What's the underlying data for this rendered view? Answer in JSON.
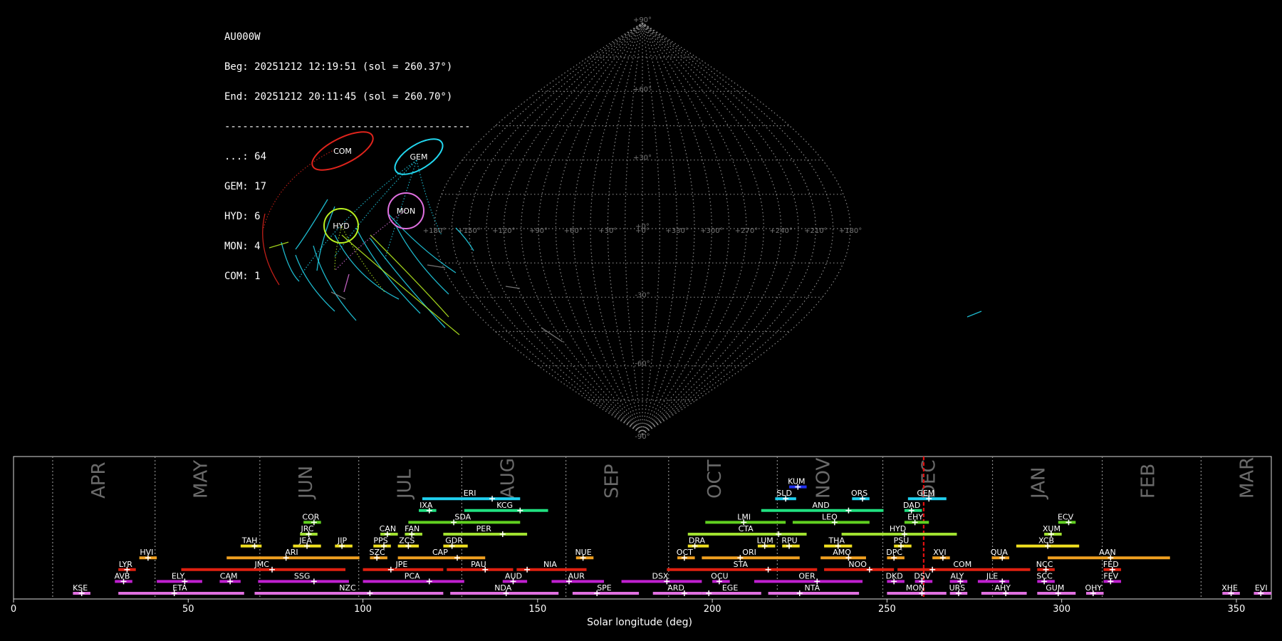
{
  "station": "AU000W",
  "beg": "Beg: 20251212 12:19:51 (sol = 260.37°)",
  "end": "End: 20251212 20:11:45 (sol = 260.70°)",
  "separator": "-----------------------------------------",
  "counts": [
    "...: 64",
    "GEM: 17",
    "HYD: 6",
    "MON: 4",
    "COM: 1"
  ],
  "sky_map": {
    "lat_labels": [
      "+90°",
      "+60°",
      "+30°",
      "+0°",
      "-30°",
      "-60°",
      "-90°"
    ],
    "lat_values": [
      90,
      60,
      30,
      0,
      -30,
      -60,
      -90
    ],
    "lon_labels": [
      "+180°",
      "+150°",
      "+120°",
      "+90°",
      "+60°",
      "+30°",
      "+0°",
      "+330°",
      "+300°",
      "+270°",
      "+240°",
      "+210°",
      "+180°"
    ],
    "radiants": [
      {
        "name": "COM",
        "color": "#e0241c"
      },
      {
        "name": "GEM",
        "color": "#22d8f0"
      },
      {
        "name": "MON",
        "color": "#e070e0"
      },
      {
        "name": "HYD",
        "color": "#b8f020"
      }
    ]
  },
  "chart_data": {
    "type": "timeline",
    "xlabel": "Solar longitude (deg)",
    "xlim": [
      0,
      360
    ],
    "xticks": [
      0,
      50,
      100,
      150,
      200,
      250,
      300,
      350
    ],
    "months": [
      {
        "label": "APR",
        "start": 11.2
      },
      {
        "label": "MAY",
        "start": 40.5
      },
      {
        "label": "JUN",
        "start": 70.5
      },
      {
        "label": "JUL",
        "start": 98.8
      },
      {
        "label": "AUG",
        "start": 128.3
      },
      {
        "label": "SEP",
        "start": 158.1
      },
      {
        "label": "OCT",
        "start": 187.5
      },
      {
        "label": "NOV",
        "start": 218.6
      },
      {
        "label": "DEC",
        "start": 248.8
      },
      {
        "label": "JAN",
        "start": 280.2
      },
      {
        "label": "FEB",
        "start": 311.6
      },
      {
        "label": "MAR",
        "start": 339.9
      }
    ],
    "current_sol": 260.5,
    "showers": [
      {
        "code": "KUM",
        "start": 222,
        "end": 227,
        "peak": 224.5,
        "row": 9,
        "color": "#2030f0"
      },
      {
        "code": "ERI",
        "start": 117,
        "end": 145,
        "peak": 137,
        "row": 8,
        "color": "#20d0f0"
      },
      {
        "code": "SLD",
        "start": 218,
        "end": 224,
        "peak": 221,
        "row": 8,
        "color": "#20d0f0"
      },
      {
        "code": "ORS",
        "start": 240,
        "end": 245,
        "peak": 243,
        "row": 8,
        "color": "#20d0f0"
      },
      {
        "code": "GEM",
        "start": 256,
        "end": 267,
        "peak": 262,
        "row": 8,
        "color": "#20d0f0"
      },
      {
        "code": "IXA",
        "start": 116,
        "end": 121,
        "peak": 119,
        "row": 7,
        "color": "#20e080"
      },
      {
        "code": "KCG",
        "start": 129,
        "end": 153,
        "peak": 145,
        "row": 7,
        "color": "#20e080"
      },
      {
        "code": "AND",
        "start": 214,
        "end": 249,
        "peak": 239,
        "row": 7,
        "color": "#20e080"
      },
      {
        "code": "DAD",
        "start": 255,
        "end": 260,
        "peak": 257,
        "row": 7,
        "color": "#20e080"
      },
      {
        "code": "COR",
        "start": 83,
        "end": 88,
        "peak": 86,
        "row": 6,
        "color": "#60d020"
      },
      {
        "code": "SDA",
        "start": 113,
        "end": 145,
        "peak": 126,
        "row": 6,
        "color": "#60d020"
      },
      {
        "code": "LMI",
        "start": 198,
        "end": 221,
        "peak": 209,
        "row": 6,
        "color": "#60d020"
      },
      {
        "code": "LEO",
        "start": 223,
        "end": 245,
        "peak": 235,
        "row": 6,
        "color": "#60d020"
      },
      {
        "code": "EHY",
        "start": 255,
        "end": 262,
        "peak": 258,
        "row": 6,
        "color": "#60d020"
      },
      {
        "code": "ECV",
        "start": 299,
        "end": 304,
        "peak": 302,
        "row": 6,
        "color": "#60d020"
      },
      {
        "code": "JRC",
        "start": 82,
        "end": 87,
        "peak": 84.5,
        "row": 5,
        "color": "#a0e030"
      },
      {
        "code": "CAN",
        "start": 105,
        "end": 110,
        "peak": 107,
        "row": 5,
        "color": "#a0e030"
      },
      {
        "code": "FAN",
        "start": 112,
        "end": 117,
        "peak": 114,
        "row": 5,
        "color": "#a0e030"
      },
      {
        "code": "PER",
        "start": 123,
        "end": 147,
        "peak": 140,
        "row": 5,
        "color": "#a0e030"
      },
      {
        "code": "CTA",
        "start": 193,
        "end": 227,
        "peak": 219,
        "row": 5,
        "color": "#a0e030"
      },
      {
        "code": "HYD",
        "start": 237,
        "end": 270,
        "peak": 255,
        "row": 5,
        "color": "#a0e030"
      },
      {
        "code": "XUM",
        "start": 295,
        "end": 300,
        "peak": 297,
        "row": 5,
        "color": "#a0e030"
      },
      {
        "code": "TAH",
        "start": 65,
        "end": 71,
        "peak": 69,
        "row": 4,
        "color": "#f0e020"
      },
      {
        "code": "JEA",
        "start": 80,
        "end": 88,
        "peak": 84,
        "row": 4,
        "color": "#f0e020"
      },
      {
        "code": "JIP",
        "start": 92,
        "end": 97,
        "peak": 94,
        "row": 4,
        "color": "#f0e020"
      },
      {
        "code": "PPS",
        "start": 103,
        "end": 108,
        "peak": 106,
        "row": 4,
        "color": "#f0e020"
      },
      {
        "code": "ZCS",
        "start": 110,
        "end": 116,
        "peak": 113,
        "row": 4,
        "color": "#f0e020"
      },
      {
        "code": "GDR",
        "start": 123,
        "end": 130,
        "peak": 125.5,
        "row": 4,
        "color": "#f0e020"
      },
      {
        "code": "DRA",
        "start": 193,
        "end": 199,
        "peak": 195,
        "row": 4,
        "color": "#f0e020"
      },
      {
        "code": "LUM",
        "start": 213,
        "end": 218,
        "peak": 215,
        "row": 4,
        "color": "#f0e020"
      },
      {
        "code": "RPU",
        "start": 220,
        "end": 225,
        "peak": 222,
        "row": 4,
        "color": "#f0e020"
      },
      {
        "code": "THA",
        "start": 232,
        "end": 240,
        "peak": 236,
        "row": 4,
        "color": "#f0e020"
      },
      {
        "code": "PSU",
        "start": 252,
        "end": 257,
        "peak": 254,
        "row": 4,
        "color": "#f0e020"
      },
      {
        "code": "XCB",
        "start": 287,
        "end": 305,
        "peak": 296,
        "row": 4,
        "color": "#f0e020"
      },
      {
        "code": "HVI",
        "start": 36,
        "end": 41,
        "peak": 38.5,
        "row": 3,
        "color": "#f0a020"
      },
      {
        "code": "ARI",
        "start": 61,
        "end": 99,
        "peak": 78,
        "row": 3,
        "color": "#f0a020"
      },
      {
        "code": "SZC",
        "start": 102,
        "end": 107,
        "peak": 104,
        "row": 3,
        "color": "#f0a020"
      },
      {
        "code": "CAP",
        "start": 110,
        "end": 135,
        "peak": 127,
        "row": 3,
        "color": "#f0a020"
      },
      {
        "code": "NUE",
        "start": 161,
        "end": 166,
        "peak": 163,
        "row": 3,
        "color": "#f0a020"
      },
      {
        "code": "OCT",
        "start": 190,
        "end": 195,
        "peak": 192,
        "row": 3,
        "color": "#f0a020"
      },
      {
        "code": "ORI",
        "start": 197,
        "end": 225,
        "peak": 208,
        "row": 3,
        "color": "#f0a020"
      },
      {
        "code": "AMO",
        "start": 231,
        "end": 244,
        "peak": 239,
        "row": 3,
        "color": "#f0a020"
      },
      {
        "code": "DPC",
        "start": 250,
        "end": 255,
        "peak": 252,
        "row": 3,
        "color": "#f0a020"
      },
      {
        "code": "XVI",
        "start": 263,
        "end": 268,
        "peak": 266,
        "row": 3,
        "color": "#f0a020"
      },
      {
        "code": "QUA",
        "start": 280,
        "end": 285,
        "peak": 283,
        "row": 3,
        "color": "#f0a020"
      },
      {
        "code": "AAN",
        "start": 296,
        "end": 331,
        "peak": 314,
        "row": 3,
        "color": "#f0a020"
      },
      {
        "code": "LYR",
        "start": 30,
        "end": 35,
        "peak": 32.5,
        "row": 2,
        "color": "#e02010"
      },
      {
        "code": "JMC",
        "start": 48,
        "end": 95,
        "peak": 74,
        "row": 2,
        "color": "#e02010"
      },
      {
        "code": "JPE",
        "start": 100,
        "end": 123,
        "peak": 108,
        "row": 2,
        "color": "#e02010"
      },
      {
        "code": "PAU",
        "start": 124,
        "end": 143,
        "peak": 135,
        "row": 2,
        "color": "#e02010"
      },
      {
        "code": "NIA",
        "start": 144,
        "end": 164,
        "peak": 147,
        "row": 2,
        "color": "#e02010"
      },
      {
        "code": "STA",
        "start": 187,
        "end": 230,
        "peak": 216,
        "row": 2,
        "color": "#e02010"
      },
      {
        "code": "NOO",
        "start": 232,
        "end": 252,
        "peak": 245,
        "row": 2,
        "color": "#e02010"
      },
      {
        "code": "COM",
        "start": 253,
        "end": 291,
        "peak": 263,
        "row": 2,
        "color": "#e02010"
      },
      {
        "code": "NCC",
        "start": 293,
        "end": 298,
        "peak": 295.5,
        "row": 2,
        "color": "#e02010"
      },
      {
        "code": "FED",
        "start": 312,
        "end": 317,
        "peak": 314.5,
        "row": 2,
        "color": "#e02010"
      },
      {
        "code": "AVB",
        "start": 29,
        "end": 34,
        "peak": 31.5,
        "row": 1,
        "color": "#c020d0"
      },
      {
        "code": "ELY",
        "start": 41,
        "end": 54,
        "peak": 49,
        "row": 1,
        "color": "#c020d0"
      },
      {
        "code": "CAM",
        "start": 59,
        "end": 65,
        "peak": 62,
        "row": 1,
        "color": "#c020d0"
      },
      {
        "code": "SSG",
        "start": 70,
        "end": 96,
        "peak": 86,
        "row": 1,
        "color": "#c020d0"
      },
      {
        "code": "PCA",
        "start": 100,
        "end": 129,
        "peak": 119,
        "row": 1,
        "color": "#c020d0"
      },
      {
        "code": "AUD",
        "start": 140,
        "end": 147,
        "peak": 143,
        "row": 1,
        "color": "#c020d0"
      },
      {
        "code": "AUR",
        "start": 154,
        "end": 169,
        "peak": 159,
        "row": 1,
        "color": "#c020d0"
      },
      {
        "code": "DSX",
        "start": 174,
        "end": 197,
        "peak": 187,
        "row": 1,
        "color": "#c020d0"
      },
      {
        "code": "OCU",
        "start": 200,
        "end": 205,
        "peak": 202,
        "row": 1,
        "color": "#c020d0"
      },
      {
        "code": "OER",
        "start": 212,
        "end": 243,
        "peak": 230,
        "row": 1,
        "color": "#c020d0"
      },
      {
        "code": "DKD",
        "start": 250,
        "end": 255,
        "peak": 252,
        "row": 1,
        "color": "#c020d0"
      },
      {
        "code": "DSV",
        "start": 258,
        "end": 263,
        "peak": 260,
        "row": 1,
        "color": "#c020d0"
      },
      {
        "code": "ALY",
        "start": 268,
        "end": 273,
        "peak": 271,
        "row": 1,
        "color": "#c020d0"
      },
      {
        "code": "JLE",
        "start": 276,
        "end": 285,
        "peak": 283,
        "row": 1,
        "color": "#c020d0"
      },
      {
        "code": "SCC",
        "start": 293,
        "end": 298,
        "peak": 295,
        "row": 1,
        "color": "#c020d0"
      },
      {
        "code": "FEV",
        "start": 312,
        "end": 317,
        "peak": 314,
        "row": 1,
        "color": "#c020d0"
      },
      {
        "code": "KSE",
        "start": 17,
        "end": 22,
        "peak": 19.5,
        "row": 0,
        "color": "#e070e0"
      },
      {
        "code": "ETA",
        "start": 30,
        "end": 66,
        "peak": 46,
        "row": 0,
        "color": "#e070e0"
      },
      {
        "code": "NZC",
        "start": 69,
        "end": 123,
        "peak": 102,
        "row": 0,
        "color": "#e070e0"
      },
      {
        "code": "NDA",
        "start": 125,
        "end": 156,
        "peak": 141,
        "row": 0,
        "color": "#e070e0"
      },
      {
        "code": "SPE",
        "start": 160,
        "end": 179,
        "peak": 167,
        "row": 0,
        "color": "#e070e0"
      },
      {
        "code": "ARD",
        "start": 183,
        "end": 197,
        "peak": 192,
        "row": 0,
        "color": "#e070e0"
      },
      {
        "code": "EGE",
        "start": 197,
        "end": 214,
        "peak": 199,
        "row": 0,
        "color": "#e070e0"
      },
      {
        "code": "NTA",
        "start": 216,
        "end": 242,
        "peak": 225,
        "row": 0,
        "color": "#e070e0"
      },
      {
        "code": "MON",
        "start": 250,
        "end": 267,
        "peak": 260,
        "row": 0,
        "color": "#e070e0"
      },
      {
        "code": "URS",
        "start": 268,
        "end": 273,
        "peak": 270.5,
        "row": 0,
        "color": "#e070e0"
      },
      {
        "code": "AHY",
        "start": 277,
        "end": 290,
        "peak": 284,
        "row": 0,
        "color": "#e070e0"
      },
      {
        "code": "GUM",
        "start": 293,
        "end": 304,
        "peak": 299,
        "row": 0,
        "color": "#e070e0"
      },
      {
        "code": "OHY",
        "start": 307,
        "end": 312,
        "peak": 309,
        "row": 0,
        "color": "#e070e0"
      },
      {
        "code": "XHE",
        "start": 346,
        "end": 351,
        "peak": 348.5,
        "row": 0,
        "color": "#e070e0"
      },
      {
        "code": "EVI",
        "start": 355,
        "end": 360,
        "peak": 357,
        "row": 0,
        "color": "#e070e0"
      }
    ]
  }
}
